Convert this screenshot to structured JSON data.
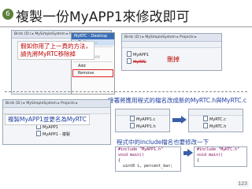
{
  "header": {
    "bullet": "6",
    "title": "複製一份MyAPP1來修改即可"
  },
  "top_window": {
    "tabs": "Birds (D:) ▸ MySimpleSystem ▸ Projects ▸",
    "menu_header": "MyRTC - Desktop",
    "menu_items": [
      "Options...",
      "Clean",
      "Show Build",
      "Add",
      "Remove"
    ],
    "tree_items": [
      "MyAPP1",
      "MyRTC"
    ],
    "note_lines": [
      "假如你用了上一頁的方法，",
      "請先將MyRTC移除掉"
    ],
    "delete_label": "刪掉"
  },
  "bottom_left_window": {
    "tabs": "Birds (D:) ▸ MySimpleSystem ▸ Projects ▸",
    "note": "複製MyAPP1並更名為MyRTC",
    "tree_items": [
      "MyAPP1",
      "MyAPP1 - 複製"
    ]
  },
  "bottom_right": {
    "instruction": "接著將應用程式的檔名改成新的MyRTC.h與MyRTC.c",
    "before_files": [
      "MyAPP1.c",
      "MyAPP1.h"
    ],
    "after_files": [
      "MyRTC.c",
      "MyRTC.h"
    ],
    "code_instruction": "程式中的include檔名也要修改一下",
    "code_before": [
      "#include \"MyAPP1.h\"",
      "void main()",
      "{",
      "  uint8 i, percent_bar;"
    ],
    "code_after": [
      "#include \"MyRTC.h\"",
      "void main()",
      "{"
    ]
  },
  "page_number": "123",
  "colors": {
    "accent_red": "#c00000",
    "accent_blue": "#1f3fa0",
    "bullet_green": "#5b7f3a"
  }
}
